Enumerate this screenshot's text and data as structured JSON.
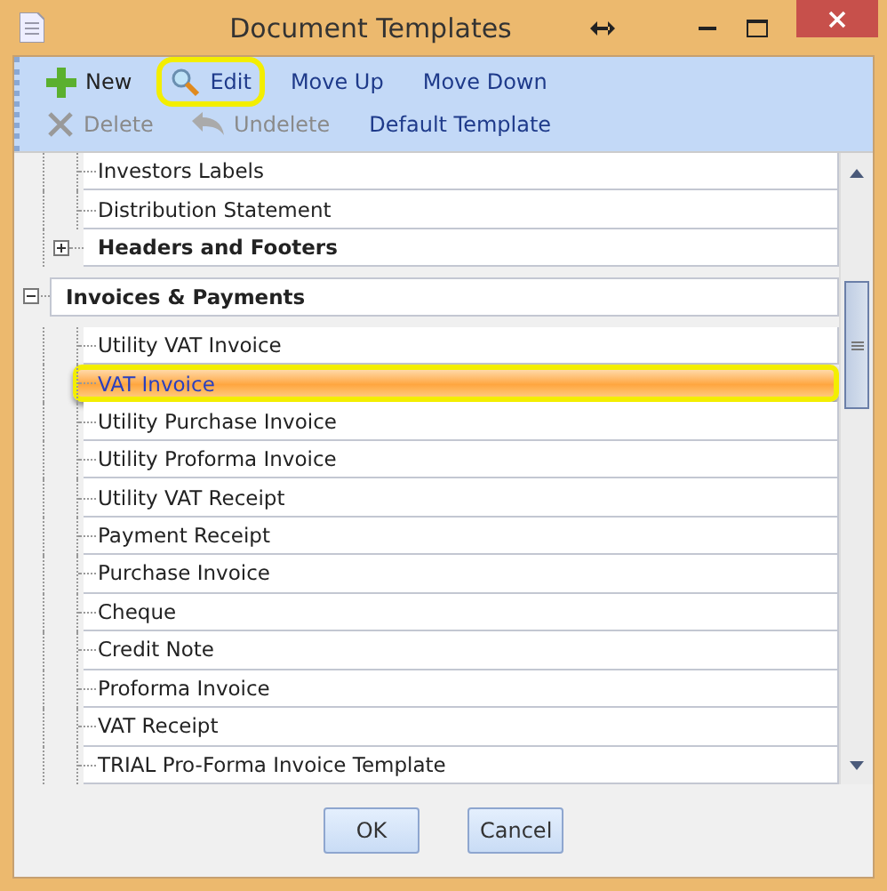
{
  "window": {
    "title": "Document Templates"
  },
  "toolbar": [
    [
      {
        "label": "New",
        "kind": "new",
        "disabled": false,
        "highlighted": false
      },
      {
        "label": "Edit",
        "kind": "edit",
        "disabled": false,
        "highlighted": true
      },
      {
        "label": "Move Up",
        "kind": "plain",
        "disabled": false,
        "highlighted": false
      },
      {
        "label": "Move Down",
        "kind": "plain",
        "disabled": false,
        "highlighted": false
      }
    ],
    [
      {
        "label": "Delete",
        "kind": "delete",
        "disabled": true,
        "highlighted": false
      },
      {
        "label": "Undelete",
        "kind": "undelete",
        "disabled": true,
        "highlighted": false
      },
      {
        "label": "Default Template",
        "kind": "plain",
        "disabled": false,
        "highlighted": false
      }
    ]
  ],
  "tree": {
    "scrolled_group_children": [
      {
        "label": "Investors Labels",
        "selected": false
      },
      {
        "label": "Distribution Statement",
        "selected": false
      },
      {
        "label": "Headers and Footers",
        "selected": false,
        "expanded": false
      }
    ],
    "groups": [
      {
        "label": "Invoices & Payments",
        "expanded": true,
        "children": [
          {
            "label": "Utility VAT Invoice",
            "selected": false
          },
          {
            "label": "VAT Invoice",
            "selected": true
          },
          {
            "label": "Utility Purchase Invoice",
            "selected": false
          },
          {
            "label": "Utility Proforma Invoice",
            "selected": false
          },
          {
            "label": "Utility VAT Receipt",
            "selected": false
          },
          {
            "label": "Payment Receipt",
            "selected": false
          },
          {
            "label": "Purchase Invoice",
            "selected": false
          },
          {
            "label": "Cheque",
            "selected": false
          },
          {
            "label": "Credit Note",
            "selected": false
          },
          {
            "label": "Proforma Invoice",
            "selected": false
          },
          {
            "label": "VAT Receipt",
            "selected": false
          },
          {
            "label": "TRIAL Pro-Forma Invoice Template",
            "selected": false
          }
        ]
      }
    ]
  },
  "buttons": [
    "OK",
    "Cancel"
  ]
}
